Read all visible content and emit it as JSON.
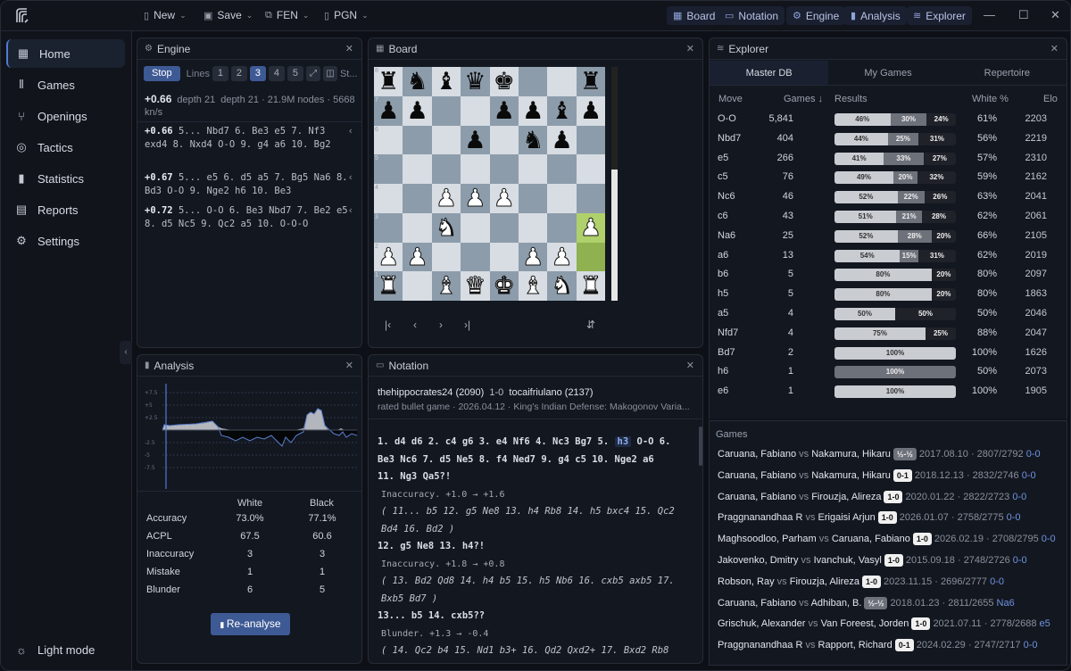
{
  "topbar": {
    "menus": [
      {
        "label": "New",
        "icon": "file-icon"
      },
      {
        "label": "Save",
        "icon": "save-icon"
      },
      {
        "label": "FEN",
        "icon": "copy-icon"
      },
      {
        "label": "PGN",
        "icon": "file-code-icon"
      }
    ],
    "toggles": [
      {
        "label": "Board"
      },
      {
        "label": "Notation"
      },
      {
        "label": "Engine"
      },
      {
        "label": "Analysis"
      },
      {
        "label": "Explorer"
      }
    ]
  },
  "sidebar": {
    "items": [
      {
        "label": "Home"
      },
      {
        "label": "Games"
      },
      {
        "label": "Openings"
      },
      {
        "label": "Tactics"
      },
      {
        "label": "Statistics"
      },
      {
        "label": "Reports"
      },
      {
        "label": "Settings"
      }
    ],
    "footer": "Light mode"
  },
  "engine": {
    "title": "Engine",
    "stop": "Stop",
    "lines_label": "Lines",
    "line_options": [
      "1",
      "2",
      "3",
      "4",
      "5"
    ],
    "selected_line": "3",
    "extra": "St...",
    "eval": "+0.66",
    "depth1": "depth 21",
    "info": "depth 21 · 21.9M nodes · 5668 kn/s",
    "pvs": [
      {
        "eval": "+0.66",
        "moves": "5... Nbd7 6. Be3 e5 7. Nf3 exd4 8. Nxd4 O-O 9. g4 a6 10. Bg2"
      },
      {
        "eval": "+0.67",
        "moves": "5... e5 6. d5 a5 7. Bg5 Na6 8. Bd3 O-O 9. Nge2 h6 10. Be3"
      },
      {
        "eval": "+0.72",
        "moves": "5... O-O 6. Be3 Nbd7 7. Be2 e5 8. d5 Nc5 9. Qc2 a5 10. O-O-O"
      }
    ]
  },
  "board": {
    "title": "Board",
    "eval_white_fraction": 0.56,
    "rank_labels": [
      "8",
      "7",
      "6",
      "5",
      "4",
      "3",
      "2",
      "1"
    ]
  },
  "analysis": {
    "title": "Analysis",
    "y_ticks": [
      "+7.5",
      "+5",
      "+2.5",
      "0",
      "-2.5",
      "-5",
      "-7.5"
    ],
    "headers": [
      "White",
      "Black"
    ],
    "rows": [
      {
        "label": "Accuracy",
        "white": "73.0%",
        "black": "77.1%"
      },
      {
        "label": "ACPL",
        "white": "67.5",
        "black": "60.6"
      },
      {
        "label": "Inaccuracy",
        "white": "3",
        "black": "3"
      },
      {
        "label": "Mistake",
        "white": "1",
        "black": "1"
      },
      {
        "label": "Blunder",
        "white": "6",
        "black": "5"
      }
    ],
    "button": "Re-analyse"
  },
  "notation": {
    "title": "Notation",
    "white": "thehippocrates24 (2090)",
    "result": "1-0",
    "black": "tocaifriulano (2137)",
    "meta": "rated bullet game · 2026.04.12 · King's Indian Defense: Makogonov Varia...",
    "line1": "1.  d4  d6 2.  c4  g6 3.  e4  Nf6 4.  Nc3  Bg7 5.",
    "current": "h3",
    "line1b": "O-O 6.",
    "line2": "Be3  Nc6 7.  d5  Ne5 8.  f4  Ned7 9.  g4  c5 10.  Nge2  a6",
    "line3": "11.  Ng3  Qa5?!",
    "c1": "Inaccuracy. +1.0 → +1.6",
    "v1": "( 11...  b5 12.  g5  Ne8 13.  h4  Rb8 14.  h5  bxc4 15.  Qc2",
    "v1b": "Bd4 16.  Bd2  )",
    "line4": "12.  g5  Ne8 13.  h4?!",
    "c2": "Inaccuracy. +1.8 → +0.8",
    "v2": "( 13.  Bd2  Qd8 14.  h4  b5 15.  h5  Nb6 16.  cxb5  axb5 17.",
    "v2b": "Bxb5  Bd7  )",
    "line5": "13...  b5 14.  cxb5??",
    "c3": "Blunder. +1.3 → -0.4",
    "v3": "( 14.  Qc2  b4 15.  Nd1  b3+ 16.  Qd2  Qxd2+ 17.  Bxd2  Rb8"
  },
  "explorer": {
    "title": "Explorer",
    "tabs": [
      "Master DB",
      "My Games",
      "Repertoire"
    ],
    "cols": {
      "move": "Move",
      "games": "Games ↓",
      "results": "Results",
      "white": "White %",
      "elo": "Elo"
    },
    "rows": [
      {
        "move": "O-O",
        "games": "5,841",
        "w": 46,
        "d": 30,
        "b": 24,
        "wp": "61%",
        "elo": "2203"
      },
      {
        "move": "Nbd7",
        "games": "404",
        "w": 44,
        "d": 25,
        "b": 31,
        "wp": "56%",
        "elo": "2219"
      },
      {
        "move": "e5",
        "games": "266",
        "w": 41,
        "d": 33,
        "b": 27,
        "wp": "57%",
        "elo": "2310"
      },
      {
        "move": "c5",
        "games": "76",
        "w": 49,
        "d": 20,
        "b": 32,
        "wp": "59%",
        "elo": "2162"
      },
      {
        "move": "Nc6",
        "games": "46",
        "w": 52,
        "d": 22,
        "b": 26,
        "wp": "63%",
        "elo": "2041"
      },
      {
        "move": "c6",
        "games": "43",
        "w": 51,
        "d": 21,
        "b": 28,
        "wp": "62%",
        "elo": "2061"
      },
      {
        "move": "Na6",
        "games": "25",
        "w": 52,
        "d": 28,
        "b": 20,
        "wp": "66%",
        "elo": "2105"
      },
      {
        "move": "a6",
        "games": "13",
        "w": 54,
        "d": 15,
        "b": 31,
        "wp": "62%",
        "elo": "2019"
      },
      {
        "move": "b6",
        "games": "5",
        "w": 80,
        "d": 0,
        "b": 20,
        "wp": "80%",
        "elo": "2097"
      },
      {
        "move": "h5",
        "games": "5",
        "w": 80,
        "d": 0,
        "b": 20,
        "wp": "80%",
        "elo": "1863"
      },
      {
        "move": "a5",
        "games": "4",
        "w": 50,
        "d": 0,
        "b": 50,
        "wp": "50%",
        "elo": "2046"
      },
      {
        "move": "Nfd7",
        "games": "4",
        "w": 75,
        "d": 0,
        "b": 25,
        "wp": "88%",
        "elo": "2047"
      },
      {
        "move": "Bd7",
        "games": "2",
        "w": 100,
        "d": 0,
        "b": 0,
        "wp": "100%",
        "elo": "1626"
      },
      {
        "move": "h6",
        "games": "1",
        "w": 0,
        "d": 100,
        "b": 0,
        "wp": "50%",
        "elo": "2073"
      },
      {
        "move": "e6",
        "games": "1",
        "w": 100,
        "d": 0,
        "b": 0,
        "wp": "100%",
        "elo": "1905"
      }
    ],
    "games_title": "Games",
    "games": [
      {
        "white": "Caruana, Fabiano",
        "black": "Nakamura, Hikaru",
        "res": "½-½",
        "date": "2017.08.10 · 2807/2792",
        "op": "0-0"
      },
      {
        "white": "Caruana, Fabiano",
        "black": "Nakamura, Hikaru",
        "res": "0-1",
        "date": "2018.12.13 · 2832/2746",
        "op": "0-0"
      },
      {
        "white": "Caruana, Fabiano",
        "black": "Firouzja, Alireza",
        "res": "1-0",
        "date": "2020.01.22 · 2822/2723",
        "op": "0-0"
      },
      {
        "white": "Praggnanandhaa R",
        "black": "Erigaisi Arjun",
        "res": "1-0",
        "date": "2026.01.07 · 2758/2775",
        "op": "0-0"
      },
      {
        "white": "Maghsoodloo, Parham",
        "black": "Caruana, Fabiano",
        "res": "1-0",
        "date": "2026.02.19 · 2708/2795",
        "op": "0-0"
      },
      {
        "white": "Jakovenko, Dmitry",
        "black": "Ivanchuk, Vasyl",
        "res": "1-0",
        "date": "2015.09.18 · 2748/2726",
        "op": "0-0"
      },
      {
        "white": "Robson, Ray",
        "black": "Firouzja, Alireza",
        "res": "1-0",
        "date": "2023.11.15 · 2696/2777",
        "op": "0-0"
      },
      {
        "white": "Caruana, Fabiano",
        "black": "Adhiban, B.",
        "res": "½-½",
        "date": "2018.01.23 · 2811/2655",
        "op": "Na6"
      },
      {
        "white": "Grischuk, Alexander",
        "black": "Van Foreest, Jorden",
        "res": "1-0",
        "date": "2021.07.11 · 2778/2688",
        "op": "e5"
      },
      {
        "white": "Praggnanandhaa R",
        "black": "Rapport, Richard",
        "res": "0-1",
        "date": "2024.02.29 · 2747/2717",
        "op": "0-0"
      }
    ]
  }
}
